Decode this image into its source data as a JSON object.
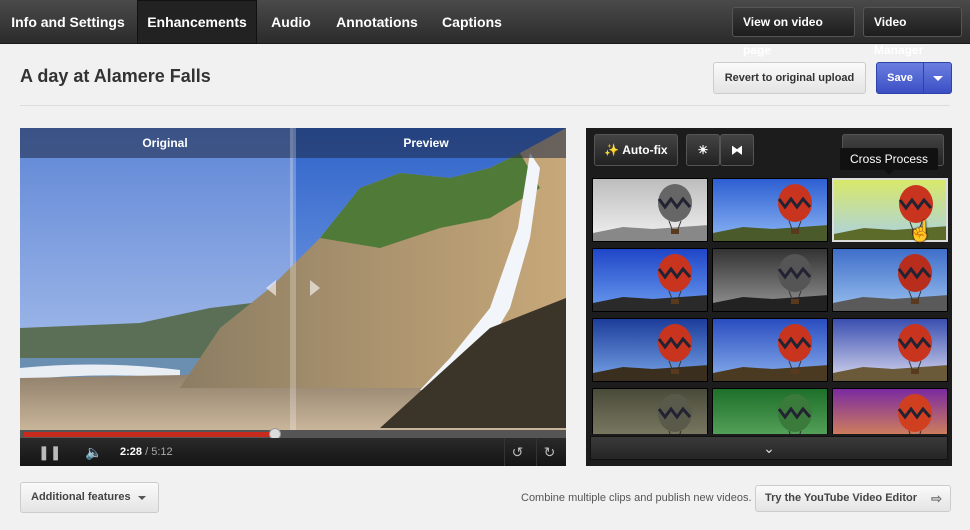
{
  "nav": {
    "tabs": [
      {
        "label": "Info and Settings"
      },
      {
        "label": "Enhancements",
        "active": true
      },
      {
        "label": "Audio"
      },
      {
        "label": "Annotations"
      },
      {
        "label": "Captions"
      }
    ],
    "view_on_page": "View on video page",
    "video_manager": "Video Manager"
  },
  "header": {
    "title": "A day at Alamere Falls",
    "revert_label": "Revert to original upload",
    "save_label": "Save"
  },
  "player": {
    "original_label": "Original",
    "preview_label": "Preview",
    "current_time": "2:28",
    "separator": " / ",
    "duration": "5:12",
    "progress": 0.474
  },
  "effects": {
    "autofix_label": "Auto-fix",
    "tooltip": "Cross Process",
    "filters_selected_index": 2,
    "filter_icon": "balloon-icon"
  },
  "footer": {
    "additional_features": "Additional features",
    "combine_text": "Combine multiple clips and publish new videos.",
    "try_editor": "Try the YouTube Video Editor"
  },
  "colors": {
    "save_blue": "#3b4fc5",
    "progress_red": "#c62b1e",
    "nav_dark": "#2b2b2b"
  }
}
